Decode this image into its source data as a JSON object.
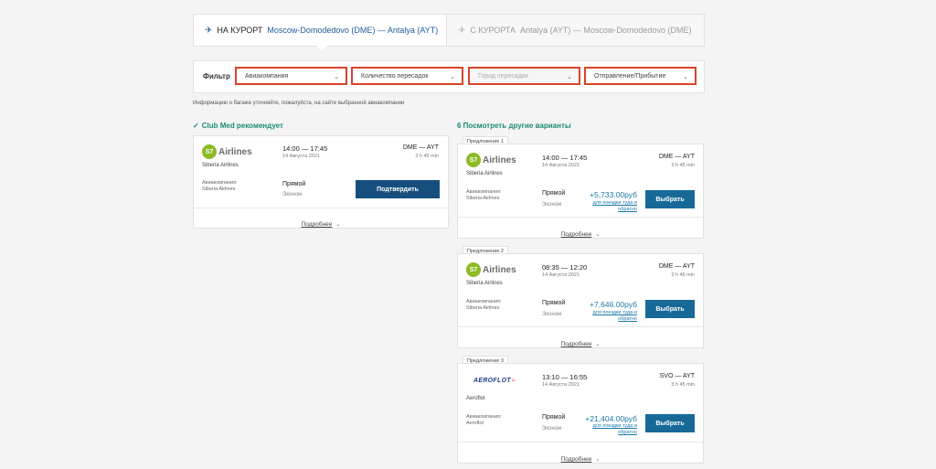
{
  "tabs": {
    "to_resort": {
      "label": "НА КУРОРТ",
      "route": "Moscow-Domodedovo (DME) — Antalya (AYT)",
      "icon": "plane-icon"
    },
    "from_resort": {
      "label": "С КУРОРТА",
      "route": "Antalya (AYT) — Moscow-Domodedovo (DME)",
      "icon": "plane-icon"
    }
  },
  "filters": {
    "label": "Фильтр",
    "airline": "Авиакомпания",
    "stops": "Количество пересадок",
    "transfer_city": "Город пересадки",
    "departure_arrival": "Отправление/Прибытие"
  },
  "baggage_note": "Информацию о багаже уточняйте, пожалуйста, на сайте выбранной авиакомпании",
  "recommended": {
    "title": "Club Med рекомендует",
    "card": {
      "logo_short": "S7",
      "logo_text": "Airlines",
      "airline": "Siberia Airlines",
      "times": "14:00 — 17:45",
      "date": "14 Августа 2021",
      "route": "DME — AYT",
      "duration": "3 h 45 min",
      "company_label": "Авиакомпания:",
      "company": "Siberia Airlines",
      "stops": "Прямой",
      "class": "Эконом",
      "button": "Подтвердить",
      "more": "Подробнее"
    }
  },
  "others": {
    "title": "6 Посмотреть другие варианты",
    "offers": [
      {
        "tag": "Предложение 1",
        "logo_short": "S7",
        "logo_text": "Airlines",
        "airline": "Siberia Airlines",
        "times": "14:00 — 17:45",
        "date": "14 Августа 2021",
        "route": "DME — AYT",
        "duration": "3 h 45 min",
        "company_label": "Авиакомпания:",
        "company": "Siberia Airlines",
        "stops": "Прямой",
        "class": "Эконом",
        "price": "+5,733.00руб",
        "price_note": "для поездки туда и обратно",
        "button": "Выбрать",
        "more": "Подробнее"
      },
      {
        "tag": "Предложение 2",
        "logo_short": "S7",
        "logo_text": "Airlines",
        "airline": "Siberia Airlines",
        "times": "08:35 — 12:20",
        "date": "14 Августа 2021",
        "route": "DME — AYT",
        "duration": "3 h 45 min",
        "company_label": "Авиакомпания:",
        "company": "Siberia Airlines",
        "stops": "Прямой",
        "class": "Эконом",
        "price": "+7,646.00руб",
        "price_note": "для поездки туда и обратно",
        "button": "Выбрать",
        "more": "Подробнее"
      },
      {
        "tag": "Предложение 3",
        "logo_text": "AEROFLOT",
        "airline": "Aeroflot",
        "times": "13:10 — 16:55",
        "date": "14 Августа 2021",
        "route": "SVO — AYT",
        "duration": "3 h 45 min",
        "company_label": "Авиакомпания:",
        "company": "Aeroflot",
        "stops": "Прямой",
        "class": "Эконом",
        "price": "+21,404.00руб",
        "price_note": "для поездки туда и обратно",
        "button": "Выбрать",
        "more": "Подробнее"
      }
    ]
  },
  "colors": {
    "accent": "#176a98",
    "confirm": "#164f7e",
    "recommend": "#1d8a76",
    "filter_highlight": "#d9432a",
    "s7": "#8dbb25"
  }
}
